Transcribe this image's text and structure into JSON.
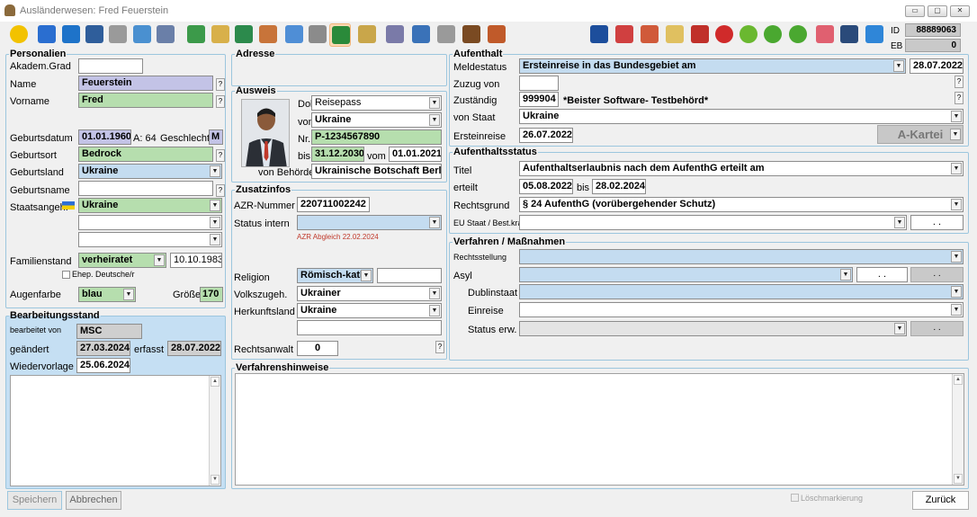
{
  "window": {
    "title": "Ausländerwesen: Fred Feuerstein",
    "btn_min": "▭",
    "btn_max": "▢",
    "btn_close": "✕"
  },
  "idbox": {
    "id_label": "ID",
    "id_value": "88889063",
    "eb_label": "EB",
    "eb_value": "0"
  },
  "toolbar": {
    "left": [
      "warning-icon",
      "passport-icon",
      "blue-square-icon",
      "device-icon",
      "phone-icon",
      "books-icon",
      "table-icon",
      "users-icon",
      "folder-user-icon",
      "arrows-icon",
      "house-icon",
      "gear-star-icon",
      "map-icon",
      "person-green-icon",
      "certificate-icon",
      "grid-icon",
      "edit-icon",
      "notes-icon",
      "gavel-icon",
      "hand-icon"
    ],
    "right": [
      "info-icon",
      "no-icon",
      "target-icon",
      "pencil-icon",
      "wheel-icon",
      "triangle-warning-icon",
      "virus-green-icon",
      "virus-up-icon",
      "virus-check-icon",
      "fingerprint-icon",
      "officer-icon",
      "download-arrow-icon"
    ]
  },
  "personalien": {
    "legend": "Personalien",
    "akadem_label": "Akadem.Grad",
    "akadem_value": "",
    "name_label": "Name",
    "name_value": "Feuerstein",
    "vorname_label": "Vorname",
    "vorname_value": "Fred",
    "geburtsdatum_label": "Geburtsdatum",
    "geburtsdatum_value": "01.01.1960",
    "alter_label": "A: 64",
    "geschlecht_label": "Geschlecht",
    "geschlecht_value": "M",
    "geburtsort_label": "Geburtsort",
    "geburtsort_value": "Bedrock",
    "geburtsland_label": "Geburtsland",
    "geburtsland_value": "Ukraine",
    "geburtsname_label": "Geburtsname",
    "geburtsname_value": "",
    "staatsangeh_label": "Staatsangeh.",
    "staatsangeh_value": "Ukraine",
    "familienstand_label": "Familienstand",
    "familienstand_value": "verheiratet",
    "familienstand_date": "10.10.1983",
    "ehep_label": "Ehep. Deutsche/r",
    "augenfarbe_label": "Augenfarbe",
    "augenfarbe_value": "blau",
    "groesse_label": "Größe",
    "groesse_value": "170",
    "qm": "?"
  },
  "bearbeitung": {
    "legend": "Bearbeitungsstand",
    "bearbeitet_label": "bearbeitet von",
    "bearbeitet_value": "MSC",
    "geaendert_label": "geändert",
    "geaendert_value": "27.03.2024",
    "erfasst_label": "erfasst",
    "erfasst_value": "28.07.2022",
    "wiedervorlage_label": "Wiedervorlage",
    "wiedervorlage_value": "25.06.2024"
  },
  "adresse": {
    "legend": "Adresse"
  },
  "ausweis": {
    "legend": "Ausweis",
    "dok_label": "Dok",
    "dok_value": "Reisepass",
    "von_label": "von",
    "von_value": "Ukraine",
    "nr_label": "Nr.",
    "nr_value": "P-1234567890",
    "bis_label": "bis",
    "bis_value": "31.12.2030",
    "vom_label": "vom",
    "vom_value": "01.01.2021",
    "behoerde_label": "von Behörde",
    "behoerde_value": "Ukrainische Botschaft Berlin"
  },
  "zusatz": {
    "legend": "Zusatzinfos",
    "azr_label": "AZR-Nummer",
    "azr_value": "220711002242",
    "status_label": "Status intern",
    "status_value": "",
    "azr_abgleich": "AZR Abgleich 22.02.2024",
    "religion_label": "Religion",
    "religion_value": "Römisch-katho",
    "volk_label": "Volkszugeh.",
    "volk_value": "Ukrainer",
    "herkunft_label": "Herkunftsland",
    "herkunft_value": "Ukraine",
    "anwalt_label": "Rechtsanwalt",
    "anwalt_value": "0",
    "qm": "?"
  },
  "aufenthalt": {
    "legend": "Aufenthalt",
    "meldestatus_label": "Meldestatus",
    "meldestatus_value": "Ersteinreise in das Bundesgebiet am",
    "meldestatus_date": "28.07.2022",
    "zuzug_label": "Zuzug von",
    "zustaendig_label": "Zuständig",
    "zustaendig_code": "999904",
    "zustaendig_name": "*Beister Software- Testbehörd*",
    "vonstaat_label": "von Staat",
    "vonstaat_value": "Ukraine",
    "ersteinreise_label": "Ersteinreise",
    "ersteinreise_value": "26.07.2022",
    "akartei_label": "A-Kartei",
    "qm": "?"
  },
  "aufstatus": {
    "legend": "Aufenthaltsstatus",
    "titel_label": "Titel",
    "titel_value": "Aufenthaltserlaubnis nach dem AufenthG erteilt am",
    "erteilt_label": "erteilt",
    "erteilt_value": "05.08.2022",
    "bis_label": "bis",
    "bis_value": "28.02.2024",
    "rechtsgrund_label": "Rechtsgrund",
    "rechtsgrund_value": "§ 24 AufenthG (vorübergehender Schutz)",
    "eu_label": "EU Staat / Best.kra",
    "eu_dots": ". ."
  },
  "verfahren": {
    "legend": "Verfahren / Maßnahmen",
    "rechtsstellung_label": "Rechtsstellung",
    "asyl_label": "Asyl",
    "dots": ". .",
    "dublin_label": "Dublinstaat",
    "einreise_label": "Einreise",
    "statuserw_label": "Status erw."
  },
  "hinweise": {
    "legend": "Verfahrenshinweise"
  },
  "footer": {
    "speichern": "Speichern",
    "abbrechen": "Abbrechen",
    "loesch": "Löschmarkierung",
    "zurueck": "Zurück"
  }
}
